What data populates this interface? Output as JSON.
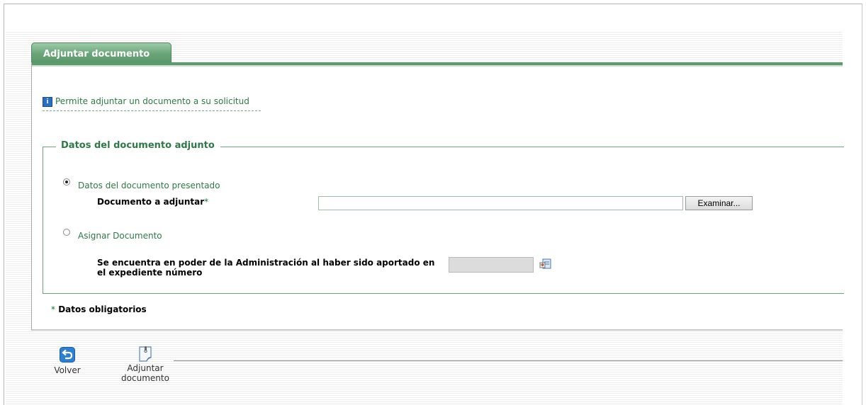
{
  "tab": {
    "label": "Adjuntar documento"
  },
  "info": {
    "text": "Permite adjuntar un documento a su solicitud"
  },
  "fieldset": {
    "legend": "Datos del documento adjunto"
  },
  "option_presented": {
    "label": "Datos del documento presentado",
    "checked": true,
    "field_label": "Documento a adjuntar",
    "required_mark": "*",
    "file_value": "",
    "browse_label": "Examinar..."
  },
  "option_assign": {
    "label": "Asignar Documento",
    "checked": false,
    "field_label_line1": "Se encuentra en poder de la Administración al haber sido aportado en",
    "field_label_line2": "el expediente número",
    "expediente_value": ""
  },
  "footnote": {
    "mark": "*",
    "text": "Datos obligatorios"
  },
  "toolbar": {
    "back_label": "Volver",
    "attach_label_line1": "Adjuntar",
    "attach_label_line2": "documento"
  },
  "colors": {
    "accent": "#5d9a6c",
    "text_green": "#2d7a45",
    "info_blue": "#2a6fc4"
  }
}
